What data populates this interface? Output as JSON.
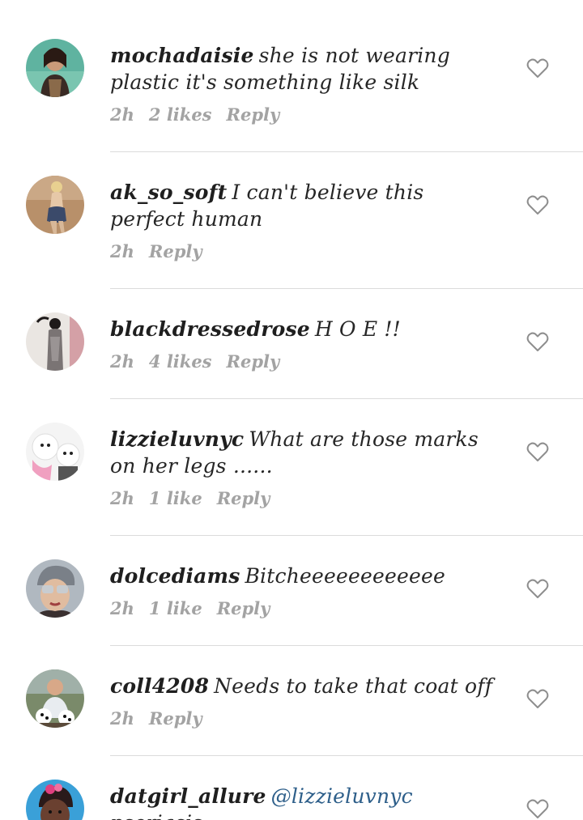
{
  "comments": [
    {
      "username": "mochadaisie",
      "text": "she is not wearing plastic it's something like silk",
      "time": "2h",
      "likes": "2 likes",
      "reply": "Reply",
      "avatar_icon": "user-avatar-icon"
    },
    {
      "username": "ak_so_soft",
      "text": "I can't believe this perfect human",
      "time": "2h",
      "likes": "",
      "reply": "Reply",
      "avatar_icon": "user-avatar-icon"
    },
    {
      "username": "blackdressedrose",
      "text": "H O E !!",
      "time": "2h",
      "likes": "4 likes",
      "reply": "Reply",
      "avatar_icon": "user-avatar-icon"
    },
    {
      "username": "lizzieluvnyc",
      "text": "What are those marks on her legs ......",
      "time": "2h",
      "likes": "1 like",
      "reply": "Reply",
      "avatar_icon": "user-avatar-icon"
    },
    {
      "username": "dolcediams",
      "text": "Bitcheeeeeeeeeeee",
      "time": "2h",
      "likes": "1 like",
      "reply": "Reply",
      "avatar_icon": "user-avatar-icon"
    },
    {
      "username": "coll4208",
      "text": "Needs to take that coat off",
      "time": "2h",
      "likes": "",
      "reply": "Reply",
      "avatar_icon": "user-avatar-icon"
    },
    {
      "username": "datgirl_allure",
      "mention": "@lizzieluvnyc",
      "text": "psoriasis",
      "avatar_icon": "user-avatar-icon"
    }
  ],
  "colors": {
    "text": "#262626",
    "meta": "#a3a3a3",
    "mention": "#2e5f8a",
    "divider": "#dbdbdb",
    "heart": "#8e8e8e"
  }
}
